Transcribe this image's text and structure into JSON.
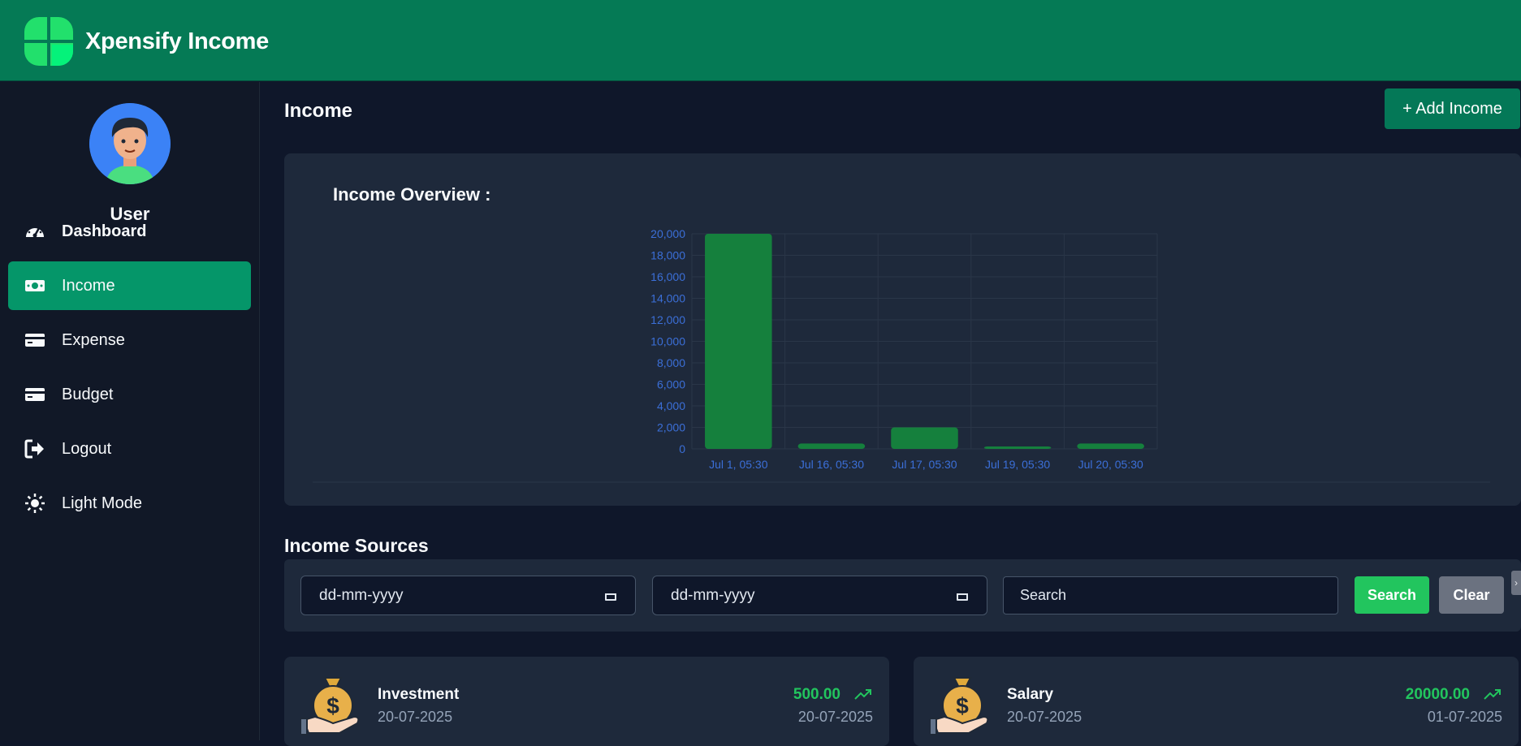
{
  "app": {
    "title": "Xpensify Income"
  },
  "sidebar": {
    "user_name": "User",
    "items": [
      {
        "label": "Dashboard",
        "icon": "gauge-icon"
      },
      {
        "label": "Income",
        "icon": "cash-icon",
        "active": true
      },
      {
        "label": "Expense",
        "icon": "credit-card-icon"
      },
      {
        "label": "Budget",
        "icon": "wallet-icon"
      },
      {
        "label": "Logout",
        "icon": "logout-icon"
      },
      {
        "label": "Light Mode",
        "icon": "sun-icon"
      }
    ]
  },
  "main": {
    "page_title": "Income",
    "add_button": "+ Add Income",
    "chart_title": "Income Overview :"
  },
  "chart_data": {
    "type": "bar",
    "categories": [
      "Jul 1, 05:30",
      "Jul 16, 05:30",
      "Jul 17, 05:30",
      "Jul 19, 05:30",
      "Jul 20, 05:30"
    ],
    "values": [
      20000,
      500,
      2000,
      100,
      500
    ],
    "ylim": [
      0,
      20000
    ],
    "yticks": [
      "0",
      "2,000",
      "4,000",
      "6,000",
      "8,000",
      "10,000",
      "12,000",
      "14,000",
      "16,000",
      "18,000",
      "20,000"
    ],
    "bar_color": "#15803d",
    "tick_color": "#3b6fd8",
    "grid": true
  },
  "sources": {
    "title": "Income Sources",
    "from_placeholder": "dd-mm-yyyy",
    "to_placeholder": "dd-mm-yyyy",
    "search_placeholder": "Search",
    "search_button": "Search",
    "clear_button": "Clear",
    "cards": [
      {
        "name": "Investment",
        "date": "20-07-2025",
        "amount": "500.00",
        "amount_date": "20-07-2025"
      },
      {
        "name": "Salary",
        "date": "20-07-2025",
        "amount": "20000.00",
        "amount_date": "01-07-2025"
      }
    ]
  },
  "colors": {
    "header": "#057a55",
    "active_nav": "#059669",
    "positive": "#22c55e",
    "background": "#0f172a",
    "card": "#1e293b"
  }
}
